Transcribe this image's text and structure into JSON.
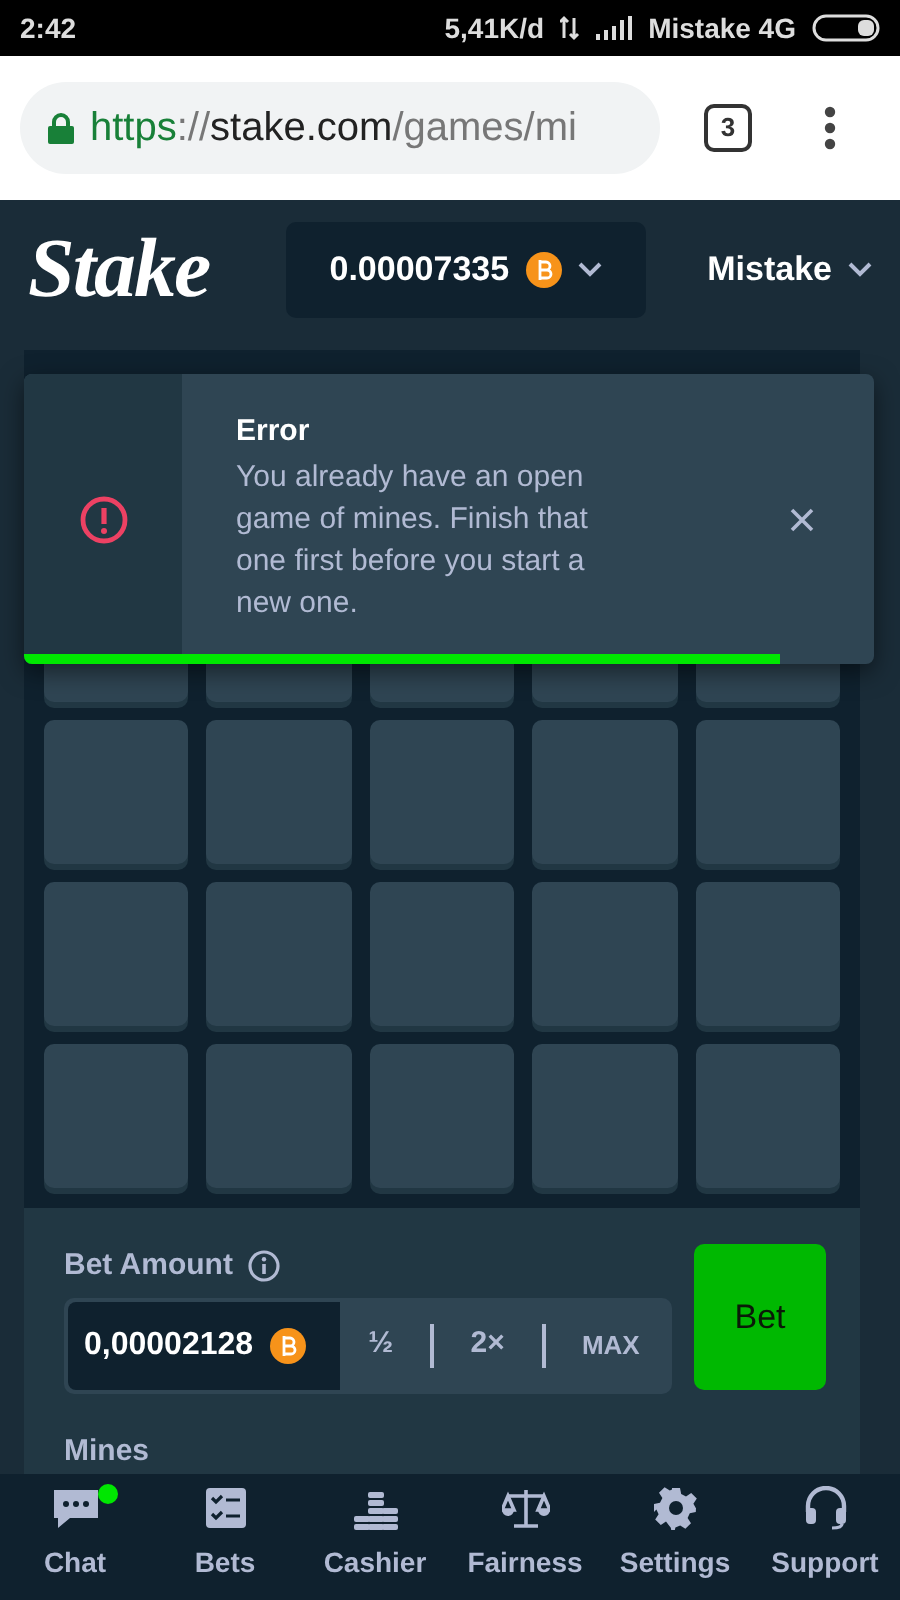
{
  "status_bar": {
    "time": "2:42",
    "speed": "5,41K/d",
    "carrier": "Mistake 4G"
  },
  "browser": {
    "url_scheme": "https",
    "url_separator": "://",
    "url_host": "stake.com",
    "url_path": "/games/mi",
    "tab_count": "3"
  },
  "header": {
    "logo": "Stake",
    "balance": "0.00007335",
    "user": "Mistake"
  },
  "toast": {
    "title": "Error",
    "message": "You already have an open game of mines. Finish that one first before you start a new one.",
    "level": 0.89
  },
  "bet": {
    "label": "Bet Amount",
    "amount": "0,00002128",
    "modifiers": [
      "½",
      "2×",
      "MAX"
    ],
    "bet_button": "Bet",
    "mines_label": "Mines"
  },
  "nav": [
    {
      "label": "Chat",
      "kind": "chat",
      "notification": true
    },
    {
      "label": "Bets",
      "kind": "bets",
      "notification": false
    },
    {
      "label": "Cashier",
      "kind": "cashier",
      "notification": false
    },
    {
      "label": "Fairness",
      "kind": "fairness",
      "notification": false
    },
    {
      "label": "Settings",
      "kind": "settings",
      "notification": false
    },
    {
      "label": "Support",
      "kind": "support",
      "notification": false
    }
  ]
}
